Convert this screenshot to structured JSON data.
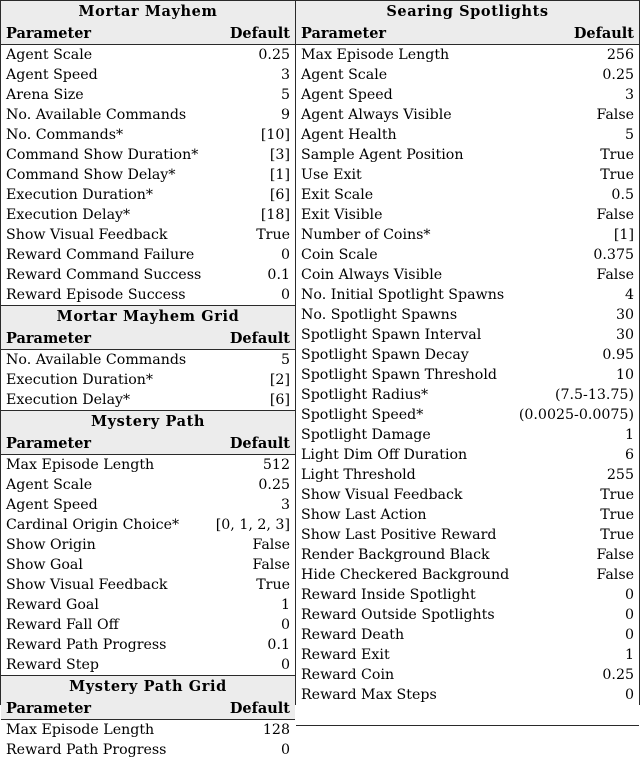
{
  "columns": {
    "left": {
      "blocks": [
        {
          "title": "Mortar Mayhem",
          "header": {
            "parameter": "Parameter",
            "default": "Default"
          },
          "rows": [
            {
              "parameter": "Agent Scale",
              "default": "0.25"
            },
            {
              "parameter": "Agent Speed",
              "default": "3"
            },
            {
              "parameter": "Arena Size",
              "default": "5"
            },
            {
              "parameter": "No. Available Commands",
              "default": "9"
            },
            {
              "parameter": "No. Commands*",
              "default": "[10]"
            },
            {
              "parameter": "Command Show Duration*",
              "default": "[3]"
            },
            {
              "parameter": "Command Show Delay*",
              "default": "[1]"
            },
            {
              "parameter": "Execution Duration*",
              "default": "[6]"
            },
            {
              "parameter": "Execution Delay*",
              "default": "[18]"
            },
            {
              "parameter": "Show Visual Feedback",
              "default": "True"
            },
            {
              "parameter": "Reward Command Failure",
              "default": "0"
            },
            {
              "parameter": "Reward Command Success",
              "default": "0.1"
            },
            {
              "parameter": "Reward Episode Success",
              "default": "0"
            }
          ]
        },
        {
          "title": "Mortar Mayhem Grid",
          "header": {
            "parameter": "Parameter",
            "default": "Default"
          },
          "rows": [
            {
              "parameter": "No. Available Commands",
              "default": "5"
            },
            {
              "parameter": "Execution Duration*",
              "default": "[2]"
            },
            {
              "parameter": "Execution Delay*",
              "default": "[6]"
            }
          ]
        },
        {
          "title": "Mystery Path",
          "header": {
            "parameter": "Parameter",
            "default": "Default"
          },
          "rows": [
            {
              "parameter": "Max Episode Length",
              "default": "512"
            },
            {
              "parameter": "Agent Scale",
              "default": "0.25"
            },
            {
              "parameter": "Agent Speed",
              "default": "3"
            },
            {
              "parameter": "Cardinal Origin Choice*",
              "default": "[0, 1, 2, 3]"
            },
            {
              "parameter": "Show Origin",
              "default": "False"
            },
            {
              "parameter": "Show Goal",
              "default": "False"
            },
            {
              "parameter": "Show Visual Feedback",
              "default": "True"
            },
            {
              "parameter": "Reward Goal",
              "default": "1"
            },
            {
              "parameter": "Reward Fall Off",
              "default": "0"
            },
            {
              "parameter": "Reward Path Progress",
              "default": "0.1"
            },
            {
              "parameter": "Reward Step",
              "default": "0"
            }
          ]
        },
        {
          "title": "Mystery Path Grid",
          "header": {
            "parameter": "Parameter",
            "default": "Default"
          },
          "rows": [
            {
              "parameter": "Max Episode Length",
              "default": "128"
            },
            {
              "parameter": "Reward Path Progress",
              "default": "0"
            }
          ]
        }
      ]
    },
    "right": {
      "blocks": [
        {
          "title": "Searing Spotlights",
          "header": {
            "parameter": "Parameter",
            "default": "Default"
          },
          "rows": [
            {
              "parameter": "Max Episode Length",
              "default": "256"
            },
            {
              "parameter": "Agent Scale",
              "default": "0.25"
            },
            {
              "parameter": "Agent Speed",
              "default": "3"
            },
            {
              "parameter": "Agent Always Visible",
              "default": "False"
            },
            {
              "parameter": "Agent Health",
              "default": "5"
            },
            {
              "parameter": "Sample Agent Position",
              "default": "True"
            },
            {
              "parameter": "Use Exit",
              "default": "True"
            },
            {
              "parameter": "Exit Scale",
              "default": "0.5"
            },
            {
              "parameter": "Exit Visible",
              "default": "False"
            },
            {
              "parameter": "Number of Coins*",
              "default": "[1]"
            },
            {
              "parameter": "Coin Scale",
              "default": "0.375"
            },
            {
              "parameter": "Coin Always Visible",
              "default": "False"
            },
            {
              "parameter": "No. Initial Spotlight Spawns",
              "default": "4"
            },
            {
              "parameter": "No. Spotlight Spawns",
              "default": "30"
            },
            {
              "parameter": "Spotlight Spawn Interval",
              "default": "30"
            },
            {
              "parameter": "Spotlight Spawn Decay",
              "default": "0.95"
            },
            {
              "parameter": "Spotlight Spawn Threshold",
              "default": "10"
            },
            {
              "parameter": "Spotlight Radius*",
              "default": "(7.5-13.75)"
            },
            {
              "parameter": "Spotlight Speed*",
              "default": "(0.0025-0.0075)"
            },
            {
              "parameter": "Spotlight Damage",
              "default": "1"
            },
            {
              "parameter": "Light Dim Off Duration",
              "default": "6"
            },
            {
              "parameter": "Light Threshold",
              "default": "255"
            },
            {
              "parameter": "Show Visual Feedback",
              "default": "True"
            },
            {
              "parameter": "Show Last Action",
              "default": "True"
            },
            {
              "parameter": "Show Last Positive Reward",
              "default": "True"
            },
            {
              "parameter": "Render Background Black",
              "default": "False"
            },
            {
              "parameter": "Hide Checkered Background",
              "default": "False"
            },
            {
              "parameter": "Reward Inside Spotlight",
              "default": "0"
            },
            {
              "parameter": "Reward Outside Spotlights",
              "default": "0"
            },
            {
              "parameter": "Reward Death",
              "default": "0"
            },
            {
              "parameter": "Reward Exit",
              "default": "1"
            },
            {
              "parameter": "Reward Coin",
              "default": "0.25"
            },
            {
              "parameter": "Reward Max Steps",
              "default": "0"
            }
          ]
        }
      ]
    }
  },
  "style": {
    "header_background": "#ececec",
    "rule_color": "#2a2a2a",
    "page_background": "#ffffff"
  }
}
